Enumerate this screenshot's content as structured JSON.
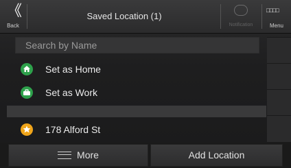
{
  "header": {
    "back_glyph": "《",
    "back_label": "Back",
    "title": "Saved Location (1)",
    "notification_label": "Notification",
    "menu_squares": "□□□□",
    "menu_label": "Menu"
  },
  "search": {
    "placeholder": "Search by Name",
    "value": ""
  },
  "list": {
    "items": [
      {
        "label": "Set as Home",
        "icon": "home-icon",
        "color": "#2ea14b"
      },
      {
        "label": "Set as Work",
        "icon": "briefcase-icon",
        "color": "#2ea14b"
      },
      {
        "label": "178 Alford St",
        "icon": "star-icon",
        "color": "#f0a51a"
      }
    ]
  },
  "bottom": {
    "more_label": "More",
    "add_location_label": "Add Location"
  }
}
